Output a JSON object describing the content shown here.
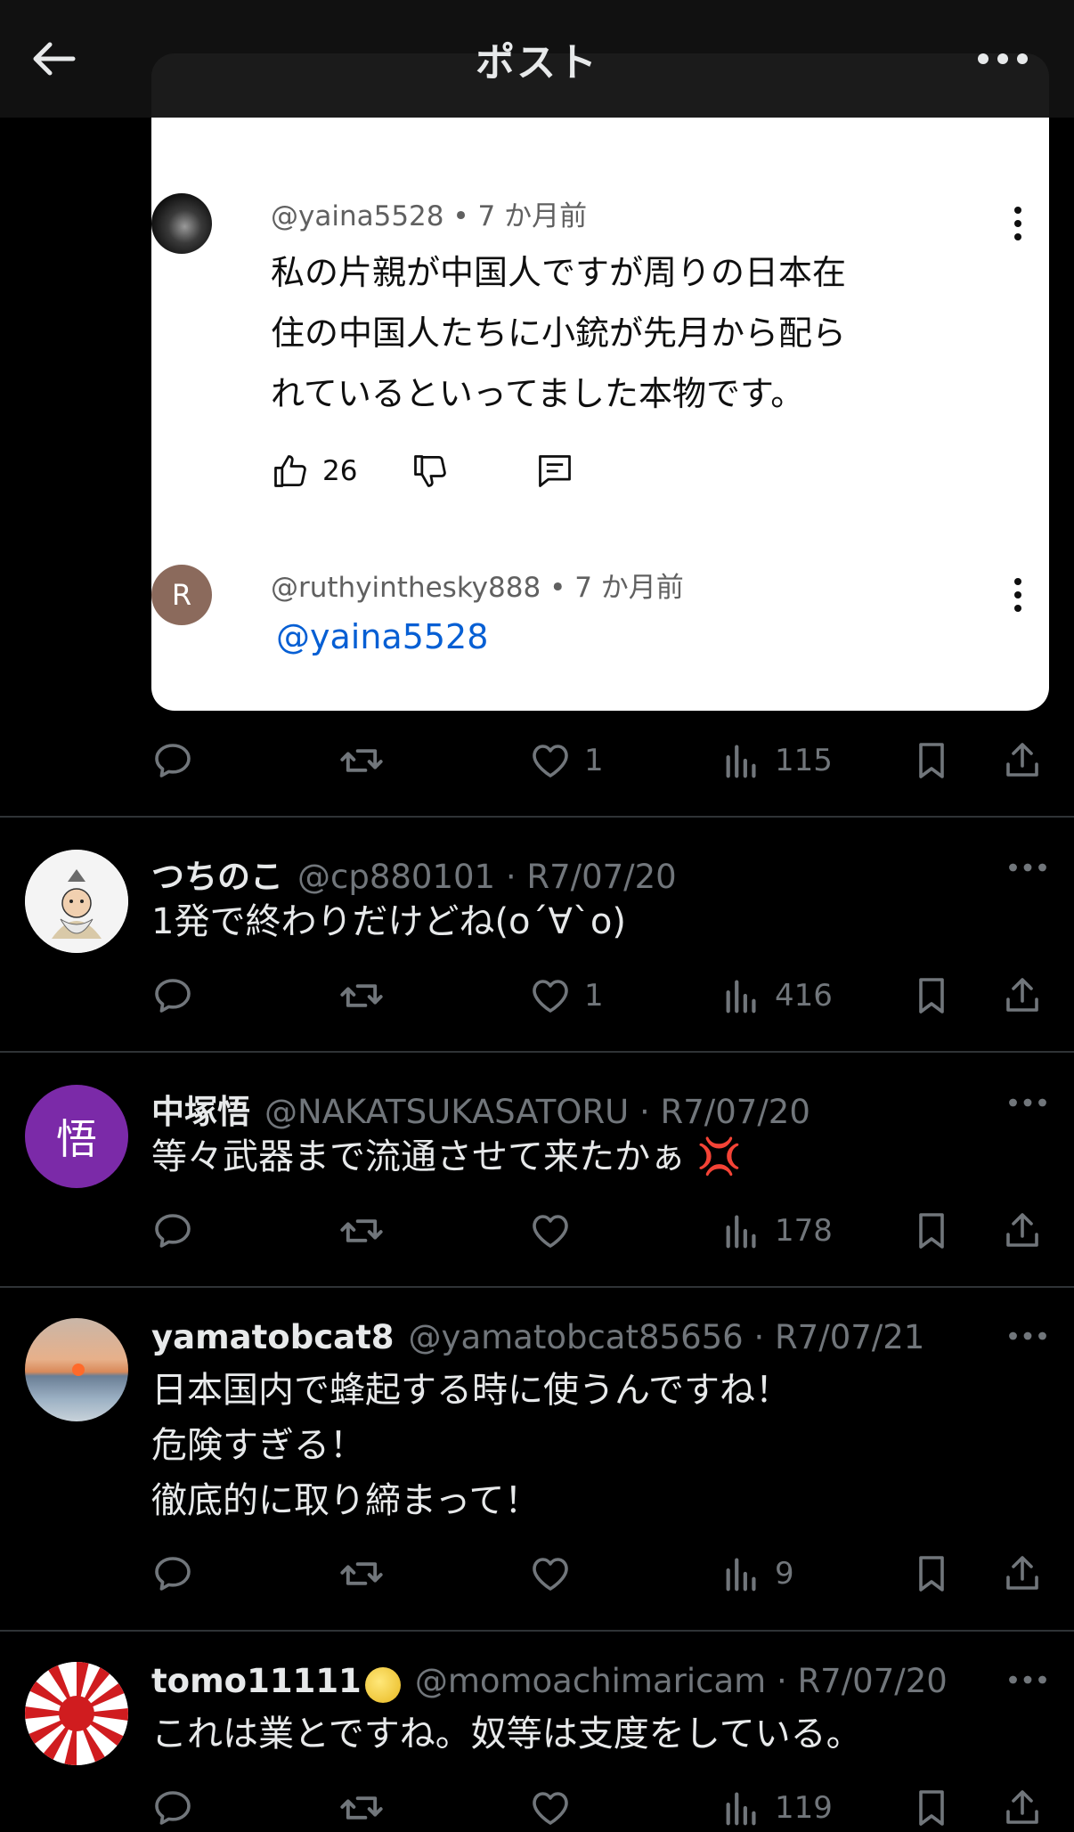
{
  "header": {
    "title": "ポスト"
  },
  "embedded": {
    "comment1": {
      "handle": "@yaina5528",
      "time": "• 7 か月前",
      "lines": [
        "私の片親が中国人ですが周りの日本在",
        "住の中国人たちに小銃が先月から配ら",
        "れているといってました本物です。"
      ],
      "likes": "26"
    },
    "comment2": {
      "avatar_letter": "R",
      "handle": "@ruthyinthesky888",
      "time": "• 7 か月前",
      "mention": "@yaina5528"
    }
  },
  "top_actions": {
    "likes": "1",
    "views": "115"
  },
  "posts": [
    {
      "name": "つちのこ",
      "handle": "@cp880101 · R7/07/20",
      "lines": [
        "1発で終わりだけどね(o´∀`o)"
      ],
      "likes": "1",
      "views": "416"
    },
    {
      "name": "中塚悟",
      "avatar_letter": "悟",
      "handle": "@NAKATSUKASATORU · R7/07/20",
      "lines": [
        "等々武器まで流通させて来たかぁ 💢"
      ],
      "likes": "",
      "views": "178"
    },
    {
      "name": "yamatobcat8",
      "handle": "@yamatobcat85656 · R7/07/21",
      "lines": [
        "日本国内で蜂起する時に使うんですね！",
        "危険すぎる！",
        "徹底的に取り締まって！"
      ],
      "likes": "",
      "views": "9"
    },
    {
      "name": "tomo11111",
      "handle": "@momoachimaricam · R7/07/20",
      "lines": [
        "これは業とですね。奴等は支度をしている。"
      ],
      "likes": "",
      "views": "119"
    }
  ],
  "colors": {
    "background": "#000000",
    "text": "#e7e9ea",
    "muted": "#71767b",
    "link": "#065fd4",
    "avatar_purple": "#7b2aa8"
  }
}
